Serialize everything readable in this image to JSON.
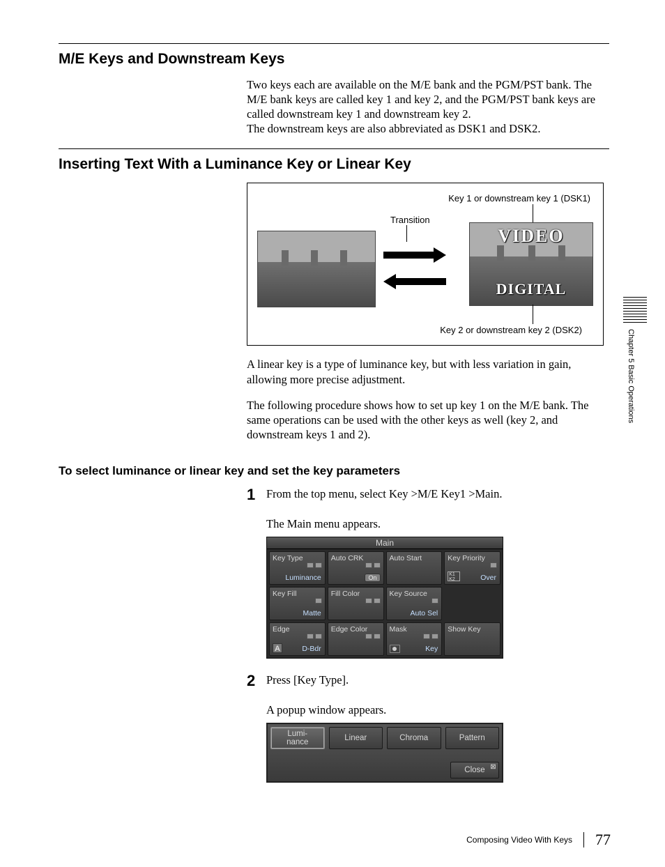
{
  "sidebar": {
    "chapter_text": "Chapter 5   Basic Operations"
  },
  "section1": {
    "title": "M/E Keys and Downstream Keys",
    "p1": "Two keys each are available on the M/E bank and the PGM/PST bank. The M/E bank keys are called key 1 and key 2, and the PGM/PST bank keys are called downstream key 1 and downstream key 2.",
    "p2": "The downstream keys are also abbreviated as DSK1 and DSK2."
  },
  "section2": {
    "title": "Inserting Text With a Luminance Key or Linear Key",
    "diagram": {
      "label_top": "Key 1 or downstream key 1 (DSK1)",
      "label_transition": "Transition",
      "label_bottom": "Key 2 or downstream key 2 (DSK2)",
      "overlay_top": "VIDEO",
      "overlay_bottom": "DIGITAL"
    },
    "p1": "A linear key is a type of luminance key, but with less variation in gain, allowing more precise adjustment.",
    "p2": "The following procedure shows how to set up key 1 on the M/E bank. The same operations can be used with the other keys as well (key 2, and downstream keys 1 and 2).",
    "sub_title": "To select luminance or linear key and set the key parameters",
    "step1": {
      "num": "1",
      "text": "From the top menu, select Key >M/E Key1 >Main.",
      "note": "The Main menu appears."
    },
    "step2": {
      "num": "2",
      "text": "Press [Key Type].",
      "note": "A popup window appears."
    }
  },
  "ui_main": {
    "title": "Main",
    "cells": {
      "key_type": {
        "label": "Key Type",
        "value": "Luminance"
      },
      "auto_crk": {
        "label": "Auto CRK",
        "value": "On"
      },
      "auto_start": {
        "label": "Auto Start",
        "value": ""
      },
      "key_priority": {
        "label": "Key Priority",
        "value": "Over"
      },
      "key_fill": {
        "label": "Key Fill",
        "value": "Matte"
      },
      "fill_color": {
        "label": "Fill Color",
        "value": ""
      },
      "key_source": {
        "label": "Key Source",
        "value": "Auto Sel"
      },
      "edge": {
        "label": "Edge",
        "value": "D-Bdr"
      },
      "edge_color": {
        "label": "Edge Color",
        "value": ""
      },
      "mask": {
        "label": "Mask",
        "value": "Key"
      },
      "show_key": {
        "label": "Show Key",
        "value": ""
      }
    }
  },
  "ui_popup": {
    "buttons": {
      "luminance": "Lumi-\nnance",
      "linear": "Linear",
      "chroma": "Chroma",
      "pattern": "Pattern"
    },
    "close": "Close"
  },
  "footer": {
    "section": "Composing Video With Keys",
    "page": "77"
  }
}
